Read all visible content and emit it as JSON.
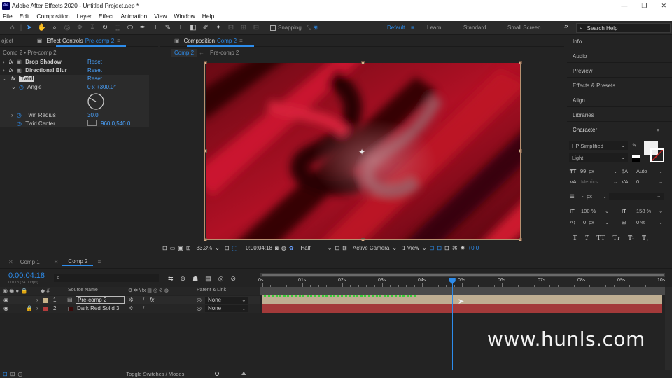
{
  "window": {
    "app_icon": "Ae",
    "title": "Adobe After Effects 2020 - Untitled Project.aep *",
    "minimize": "—",
    "restore": "❐",
    "close": "✕"
  },
  "menu": [
    "File",
    "Edit",
    "Composition",
    "Layer",
    "Effect",
    "Animation",
    "View",
    "Window",
    "Help"
  ],
  "toolbar": {
    "snapping_label": "Snapping",
    "workspaces": [
      "Default",
      "Learn",
      "Standard",
      "Small Screen"
    ],
    "active_workspace": "Default",
    "overflow": "»",
    "search_placeholder": "Search Help"
  },
  "project_tab": "oject",
  "effect_controls": {
    "tab_label": "Effect Controls",
    "tab_target": "Pre-comp 2",
    "breadcrumb": "Comp 2 • Pre-comp 2",
    "effects": [
      {
        "name": "Drop Shadow",
        "reset": "Reset"
      },
      {
        "name": "Directional Blur",
        "reset": "Reset"
      },
      {
        "name": "Twirl",
        "reset": "Reset"
      }
    ],
    "angle_label": "Angle",
    "angle_value": "0 x +300.0°",
    "twirl_radius_label": "Twirl Radius",
    "twirl_radius_value": "30.0",
    "twirl_center_label": "Twirl Center",
    "twirl_center_value": "960.0,540.0"
  },
  "composition": {
    "tab_label": "Composition",
    "tab_target": "Comp 2",
    "sub_tabs": [
      "Comp 2",
      "Pre-comp 2"
    ],
    "zoom": "33.3%",
    "timecode": "0:00:04:18",
    "resolution": "Half",
    "camera": "Active Camera",
    "view": "1 View",
    "exposure": "+0.0"
  },
  "right_panels": [
    "Info",
    "Audio",
    "Preview",
    "Effects & Presets",
    "Align",
    "Libraries"
  ],
  "character": {
    "title": "Character",
    "font": "HP Simplified",
    "style": "Light",
    "size": "99",
    "size_unit": "px",
    "leading": "Auto",
    "kerning": "Metrics",
    "tracking": "0",
    "stroke": "-",
    "stroke_unit": "px",
    "vscale": "100 %",
    "hscale": "158 %",
    "baseline": "0",
    "baseline_unit": "px",
    "tsume": "0 %",
    "styles": [
      "T",
      "T",
      "TT",
      "Tт",
      "T¹",
      "T₁"
    ]
  },
  "timeline": {
    "tabs": [
      "Comp 1",
      "Comp 2"
    ],
    "active_tab": "Comp 2",
    "timecode": "0:00:04:18",
    "fps": "00118 (24.00 fps)",
    "search_icon": "⌕",
    "col_source": "Source Name",
    "col_parent": "Parent & Link",
    "layers": [
      {
        "num": "1",
        "name": "Pre-comp 2",
        "color": "#c8b48a",
        "parent": "None"
      },
      {
        "num": "2",
        "name": "Dark Red Solid 3",
        "color": "#b43c3c",
        "parent": "None"
      }
    ],
    "ruler": [
      "0s",
      "01s",
      "02s",
      "03s",
      "04s",
      "05s",
      "06s",
      "07s",
      "08s",
      "09s",
      "10s"
    ],
    "playhead_seconds": 4.75,
    "toggle_label": "Toggle Switches / Modes"
  },
  "watermark": "www.hunls.com",
  "colors": {
    "accent": "#2d8ceb",
    "bg": "#232323",
    "layer1_bar": "#bfae92",
    "layer2_bar": "#a33a3a"
  }
}
